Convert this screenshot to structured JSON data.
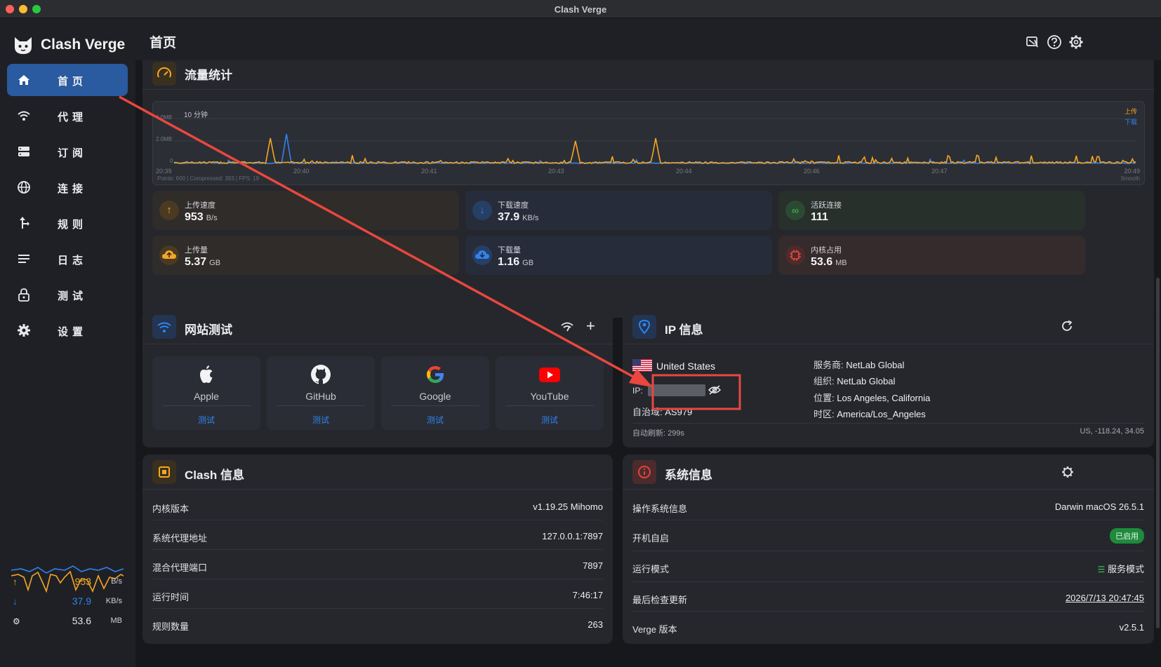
{
  "window": {
    "title": "Clash Verge"
  },
  "brand": {
    "name": "Clash Verge"
  },
  "nav": [
    {
      "label": "首页",
      "icon": "home-icon",
      "active": true
    },
    {
      "label": "代理",
      "icon": "wifi-icon"
    },
    {
      "label": "订阅",
      "icon": "server-icon"
    },
    {
      "label": "连接",
      "icon": "globe-icon"
    },
    {
      "label": "规则",
      "icon": "route-icon"
    },
    {
      "label": "日志",
      "icon": "list-icon"
    },
    {
      "label": "测试",
      "icon": "lock-icon"
    },
    {
      "label": "设置",
      "icon": "gear-icon"
    }
  ],
  "sidebar_stats": {
    "upload": {
      "value": "953",
      "unit": "B/s"
    },
    "download": {
      "value": "37.9",
      "unit": "KB/s"
    },
    "memory": {
      "value": "53.6",
      "unit": "MB"
    }
  },
  "header": {
    "title": "首页"
  },
  "traffic": {
    "title": "流量统计",
    "chart": {
      "range_label": "10 分钟",
      "y_ticks": [
        "4.0MB",
        "2.0MB",
        "0"
      ],
      "x_ticks": [
        "20:39",
        "20:40",
        "20:41",
        "20:43",
        "20:44",
        "20:46",
        "20:47",
        "20:49"
      ],
      "legend": [
        "上传",
        "下载"
      ],
      "footer_left": "Points: 600 | Compressed: 393 | FPS: 19",
      "footer_right": "Smooth",
      "colors": {
        "upload": "#f5a623",
        "download": "#2f83f0"
      }
    },
    "stats": [
      {
        "label": "上传速度",
        "value": "953",
        "unit": "B/s",
        "icon": "arrow-up-icon",
        "color": "#f5a623"
      },
      {
        "label": "下载速度",
        "value": "37.9",
        "unit": "KB/s",
        "icon": "arrow-down-icon",
        "color": "#2f83f0"
      },
      {
        "label": "活跃连接",
        "value": "111",
        "unit": "",
        "icon": "link-icon",
        "color": "#3fbf5a"
      },
      {
        "label": "上传量",
        "value": "5.37",
        "unit": "GB",
        "icon": "cloud-upload-icon",
        "color": "#f5a623"
      },
      {
        "label": "下载量",
        "value": "1.16",
        "unit": "GB",
        "icon": "cloud-download-icon",
        "color": "#2f83f0"
      },
      {
        "label": "内核占用",
        "value": "53.6",
        "unit": "MB",
        "icon": "chip-icon",
        "color": "#e0453a"
      }
    ]
  },
  "site_test": {
    "title": "网站测试",
    "sites": [
      {
        "name": "Apple",
        "action": "测试"
      },
      {
        "name": "GitHub",
        "action": "测试"
      },
      {
        "name": "Google",
        "action": "测试"
      },
      {
        "name": "YouTube",
        "action": "测试"
      }
    ]
  },
  "ip_info": {
    "title": "IP 信息",
    "country": "United States",
    "ip_label": "IP:",
    "asn_label": "自治域:",
    "asn": "AS979",
    "isp_label": "服务商:",
    "isp": "NetLab Global",
    "org_label": "组织:",
    "org": "NetLab Global",
    "location_label": "位置:",
    "location": "Los Angeles, California",
    "timezone_label": "时区:",
    "timezone": "America/Los_Angeles",
    "auto_refresh": "自动刷新: 299s",
    "coords": "US, -118.24, 34.05"
  },
  "clash_info": {
    "title": "Clash 信息",
    "rows": [
      {
        "key": "内核版本",
        "value": "v1.19.25 Mihomo"
      },
      {
        "key": "系统代理地址",
        "value": "127.0.0.1:7897"
      },
      {
        "key": "混合代理端口",
        "value": "7897"
      },
      {
        "key": "运行时间",
        "value": "7:46:17"
      },
      {
        "key": "规则数量",
        "value": "263"
      }
    ]
  },
  "sys_info": {
    "title": "系统信息",
    "os_label": "操作系统信息",
    "os": "Darwin macOS 26.5.1",
    "autostart_label": "开机自启",
    "autostart": "已启用",
    "mode_label": "运行模式",
    "mode": "服务模式",
    "update_label": "最后检查更新",
    "update": "2026/7/13 20:47:45",
    "version_label": "Verge 版本",
    "version": "v2.5.1"
  }
}
